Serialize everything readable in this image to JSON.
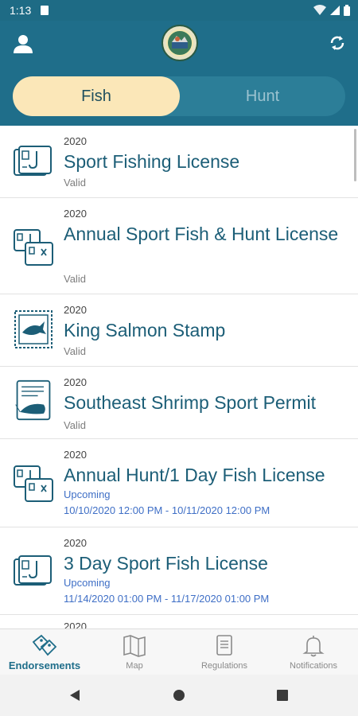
{
  "status_bar": {
    "time": "1:13"
  },
  "segments": {
    "fish": "Fish",
    "hunt": "Hunt"
  },
  "licenses": [
    {
      "year": "2020",
      "title": "Sport Fishing License",
      "status": "Valid",
      "icon": "license-card-icon"
    },
    {
      "year": "2020",
      "title": "Annual Sport Fish & Hunt License",
      "status": "Valid",
      "icon": "double-license-icon"
    },
    {
      "year": "2020",
      "title": "King Salmon Stamp",
      "status": "Valid",
      "icon": "salmon-stamp-icon"
    },
    {
      "year": "2020",
      "title": "Southeast Shrimp Sport Permit",
      "status": "Valid",
      "icon": "shrimp-permit-icon"
    },
    {
      "year": "2020",
      "title": "Annual Hunt/1 Day Fish License",
      "status": "Upcoming",
      "dates": "10/10/2020 12:00 PM - 10/11/2020 12:00 PM",
      "icon": "double-license-icon"
    },
    {
      "year": "2020",
      "title": "3 Day Sport Fish License",
      "status": "Upcoming",
      "dates": "11/14/2020 01:00 PM - 11/17/2020 01:00 PM",
      "icon": "license-card-icon"
    }
  ],
  "peek_year": "2020",
  "bottom_nav": {
    "endorsements": "Endorsements",
    "map": "Map",
    "regulations": "Regulations",
    "notifications": "Notifications"
  },
  "colors": {
    "header": "#1f6e8a",
    "accent_selected": "#fbe7b8",
    "title": "#1c5e77",
    "upcoming": "#3f6fc6"
  }
}
